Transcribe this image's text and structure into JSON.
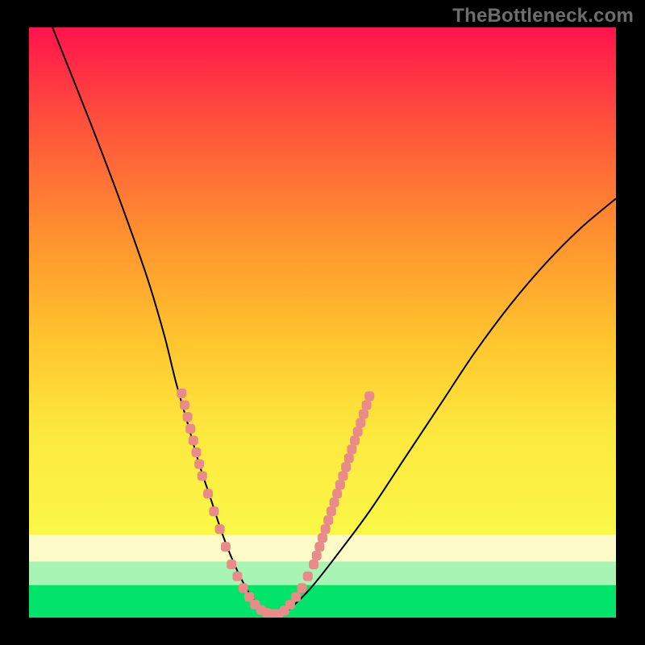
{
  "watermark": "TheBottleneck.com",
  "colors": {
    "frame": "#000000",
    "curve": "#000000",
    "markers": "#e98b89",
    "band_yellow_pale": "#fdfbc7",
    "band_green_pale": "#a7f4b5",
    "band_green": "#00e46a",
    "gradient_top": "#ff134d",
    "gradient_mid": "#ffbf2f",
    "gradient_low": "#faf846",
    "gradient_bottom": "#02e36b"
  },
  "chart_data": {
    "type": "line",
    "title": "",
    "xlabel": "",
    "ylabel": "",
    "xlim": [
      0,
      100
    ],
    "ylim": [
      0,
      100
    ],
    "legend": false,
    "grid": false,
    "annotations": [
      "TheBottleneck.com"
    ],
    "series": [
      {
        "name": "bottleneck-curve",
        "x": [
          4,
          10,
          15,
          20,
          23,
          25,
          27,
          29,
          31,
          33,
          35,
          37,
          39,
          41,
          43,
          45,
          48,
          52,
          58,
          64,
          70,
          76,
          82,
          88,
          94,
          100
        ],
        "y": [
          100,
          85,
          72,
          58,
          48,
          40,
          33,
          26,
          20,
          14,
          9,
          5,
          2,
          0.6,
          0.6,
          2,
          5,
          10,
          18,
          27,
          36,
          45,
          53,
          60,
          66,
          71
        ]
      }
    ],
    "markers": {
      "name": "highlight-dots",
      "color": "#e98b89",
      "points": [
        {
          "x": 26.0,
          "y": 38
        },
        {
          "x": 26.5,
          "y": 36
        },
        {
          "x": 27.0,
          "y": 34
        },
        {
          "x": 27.5,
          "y": 32
        },
        {
          "x": 28.0,
          "y": 30
        },
        {
          "x": 28.5,
          "y": 28
        },
        {
          "x": 29.0,
          "y": 26
        },
        {
          "x": 29.5,
          "y": 24
        },
        {
          "x": 30.5,
          "y": 21
        },
        {
          "x": 31.5,
          "y": 18
        },
        {
          "x": 32.5,
          "y": 15
        },
        {
          "x": 33.5,
          "y": 12
        },
        {
          "x": 34.5,
          "y": 9
        },
        {
          "x": 35.5,
          "y": 7
        },
        {
          "x": 36.5,
          "y": 5
        },
        {
          "x": 37.5,
          "y": 3.5
        },
        {
          "x": 38.5,
          "y": 2.2
        },
        {
          "x": 39.5,
          "y": 1.3
        },
        {
          "x": 40.5,
          "y": 0.8
        },
        {
          "x": 41.5,
          "y": 0.6
        },
        {
          "x": 42.5,
          "y": 0.6
        },
        {
          "x": 43.5,
          "y": 1.2
        },
        {
          "x": 44.5,
          "y": 2.2
        },
        {
          "x": 45.5,
          "y": 3.5
        },
        {
          "x": 46.5,
          "y": 5
        },
        {
          "x": 47.5,
          "y": 7
        },
        {
          "x": 48.5,
          "y": 9
        },
        {
          "x": 49.0,
          "y": 10.5
        },
        {
          "x": 49.5,
          "y": 12
        },
        {
          "x": 50.0,
          "y": 13.5
        },
        {
          "x": 50.5,
          "y": 15
        },
        {
          "x": 51.0,
          "y": 16.5
        },
        {
          "x": 51.5,
          "y": 18
        },
        {
          "x": 52.0,
          "y": 19.5
        },
        {
          "x": 52.5,
          "y": 21
        },
        {
          "x": 53.0,
          "y": 22.5
        },
        {
          "x": 53.5,
          "y": 24
        },
        {
          "x": 54.0,
          "y": 25.5
        },
        {
          "x": 54.5,
          "y": 27
        },
        {
          "x": 55.0,
          "y": 28.5
        },
        {
          "x": 55.5,
          "y": 30
        },
        {
          "x": 56.0,
          "y": 31.5
        },
        {
          "x": 56.5,
          "y": 33
        },
        {
          "x": 57.0,
          "y": 34.5
        },
        {
          "x": 57.5,
          "y": 36
        },
        {
          "x": 58.0,
          "y": 37.5
        }
      ]
    },
    "background_bands": [
      {
        "y_from": 100,
        "y_to": 14,
        "type": "gradient",
        "from": "#ff134d",
        "to": "#faf846"
      },
      {
        "y_from": 14,
        "y_to": 9.5,
        "color": "#fdfbc7"
      },
      {
        "y_from": 9.5,
        "y_to": 5.5,
        "color": "#a7f4b5"
      },
      {
        "y_from": 5.5,
        "y_to": 2.5,
        "color": "#00e46a"
      },
      {
        "y_from": 2.5,
        "y_to": 0,
        "color": "#02e36b"
      }
    ]
  }
}
